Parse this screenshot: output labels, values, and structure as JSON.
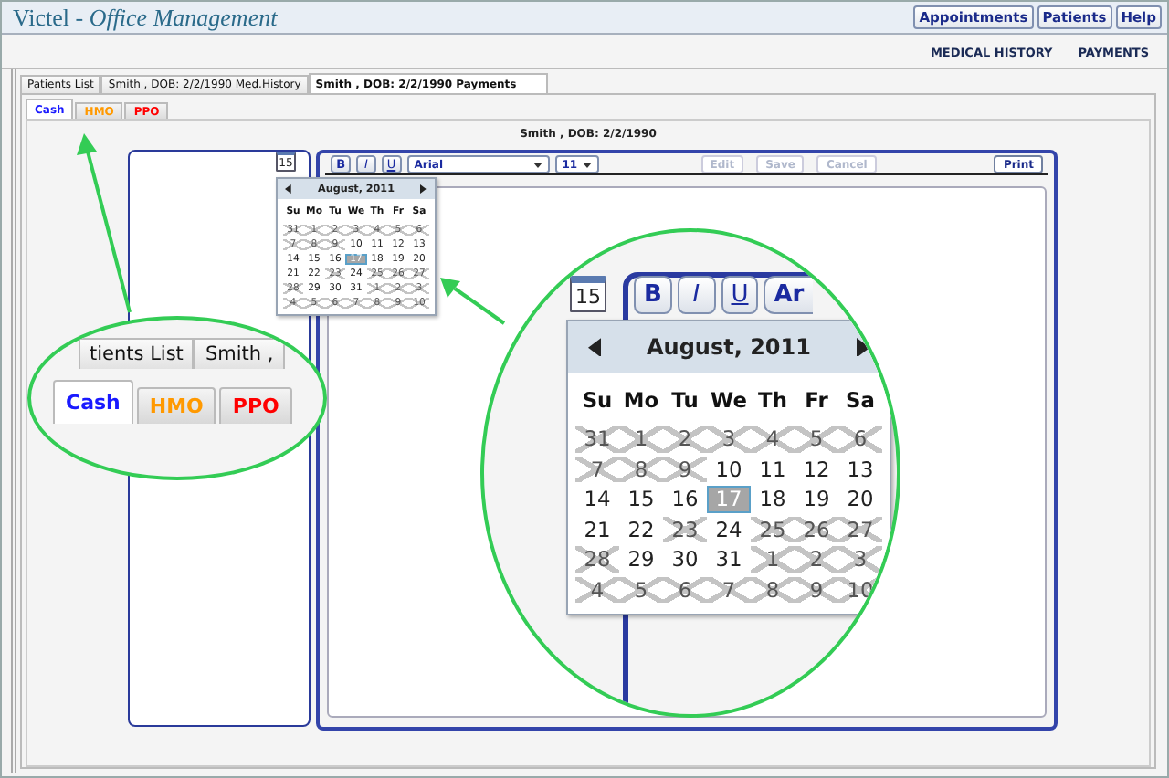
{
  "header": {
    "title": "Victel - *Office Management*",
    "buttons": [
      "Appointments",
      "Patients",
      "Help"
    ]
  },
  "nav_links": [
    "MEDICAL HISTORY",
    "PAYMENTS"
  ],
  "tabs": [
    {
      "label": "Patients List",
      "selected": false
    },
    {
      "label": "Smith , DOB: 2/2/1990 Med.History",
      "selected": false
    },
    {
      "label": "Smith , DOB: 2/2/1990 Payments",
      "selected": true
    }
  ],
  "payment_tabs": [
    {
      "label": "Cash",
      "selected": true,
      "color": "#1a1aff"
    },
    {
      "label": "HMO",
      "selected": false,
      "color": "#ff9900"
    },
    {
      "label": "PPO",
      "selected": false,
      "color": "#ff0000"
    }
  ],
  "patient_heading": "Smith , DOB: 2/2/1990",
  "calendar_icon": "15",
  "toolbar": {
    "format_buttons": [
      {
        "label": "B",
        "kind": "bold"
      },
      {
        "label": "I",
        "kind": "italic"
      },
      {
        "label": "U",
        "kind": "underline"
      }
    ],
    "font": "Arial",
    "size": "11",
    "actions": [
      {
        "label": "Edit",
        "disabled": true
      },
      {
        "label": "Save",
        "disabled": true
      },
      {
        "label": "Cancel",
        "disabled": true
      },
      {
        "label": "Print",
        "disabled": false
      }
    ]
  },
  "calendar": {
    "title": "August, 2011",
    "weekdays": [
      "Su",
      "Mo",
      "Tu",
      "We",
      "Th",
      "Fr",
      "Sa"
    ],
    "days": [
      {
        "day": "31",
        "disabled": true,
        "selected": false
      },
      {
        "day": "1",
        "disabled": true,
        "selected": false
      },
      {
        "day": "2",
        "disabled": true,
        "selected": false
      },
      {
        "day": "3",
        "disabled": true,
        "selected": false
      },
      {
        "day": "4",
        "disabled": true,
        "selected": false
      },
      {
        "day": "5",
        "disabled": true,
        "selected": false
      },
      {
        "day": "6",
        "disabled": true,
        "selected": false
      },
      {
        "day": "7",
        "disabled": true,
        "selected": false
      },
      {
        "day": "8",
        "disabled": true,
        "selected": false
      },
      {
        "day": "9",
        "disabled": true,
        "selected": false
      },
      {
        "day": "10",
        "disabled": false,
        "selected": false
      },
      {
        "day": "11",
        "disabled": false,
        "selected": false
      },
      {
        "day": "12",
        "disabled": false,
        "selected": false
      },
      {
        "day": "13",
        "disabled": false,
        "selected": false
      },
      {
        "day": "14",
        "disabled": false,
        "selected": false
      },
      {
        "day": "15",
        "disabled": false,
        "selected": false
      },
      {
        "day": "16",
        "disabled": false,
        "selected": false
      },
      {
        "day": "17",
        "disabled": false,
        "selected": true
      },
      {
        "day": "18",
        "disabled": false,
        "selected": false
      },
      {
        "day": "19",
        "disabled": false,
        "selected": false
      },
      {
        "day": "20",
        "disabled": false,
        "selected": false
      },
      {
        "day": "21",
        "disabled": false,
        "selected": false
      },
      {
        "day": "22",
        "disabled": false,
        "selected": false
      },
      {
        "day": "23",
        "disabled": true,
        "selected": false
      },
      {
        "day": "24",
        "disabled": false,
        "selected": false
      },
      {
        "day": "25",
        "disabled": true,
        "selected": false
      },
      {
        "day": "26",
        "disabled": true,
        "selected": false
      },
      {
        "day": "27",
        "disabled": true,
        "selected": false
      },
      {
        "day": "28",
        "disabled": true,
        "selected": false
      },
      {
        "day": "29",
        "disabled": false,
        "selected": false
      },
      {
        "day": "30",
        "disabled": false,
        "selected": false
      },
      {
        "day": "31",
        "disabled": false,
        "selected": false
      },
      {
        "day": "1",
        "disabled": true,
        "selected": false
      },
      {
        "day": "2",
        "disabled": true,
        "selected": false
      },
      {
        "day": "3",
        "disabled": true,
        "selected": false
      },
      {
        "day": "4",
        "disabled": true,
        "selected": false
      },
      {
        "day": "5",
        "disabled": true,
        "selected": false
      },
      {
        "day": "6",
        "disabled": true,
        "selected": false
      },
      {
        "day": "7",
        "disabled": true,
        "selected": false
      },
      {
        "day": "8",
        "disabled": true,
        "selected": false
      },
      {
        "day": "9",
        "disabled": true,
        "selected": false
      },
      {
        "day": "10",
        "disabled": true,
        "selected": false
      }
    ]
  },
  "zoom_left": {
    "tabs": [
      {
        "label": "tients List",
        "selected": false
      },
      {
        "label": "Smith ,",
        "selected": false
      }
    ],
    "payment_tabs": [
      {
        "label": "Cash",
        "selected": true,
        "color": "#1a1aff"
      },
      {
        "label": "HMO",
        "selected": false,
        "color": "#ff9900"
      },
      {
        "label": "PPO",
        "selected": false,
        "color": "#ff0000"
      }
    ]
  },
  "zoom_right": {
    "calendar_icon": "15",
    "format_buttons": [
      {
        "label": "B",
        "kind": "bold"
      },
      {
        "label": "I",
        "kind": "italic"
      },
      {
        "label": "U",
        "kind": "underline"
      }
    ],
    "font": "Ar",
    "calendar": {
      "title": "August, 2011",
      "weekdays": [
        "Su",
        "Mo",
        "Tu",
        "We",
        "Th",
        "Fr",
        "Sa"
      ],
      "days": [
        {
          "day": "31",
          "disabled": true,
          "selected": false
        },
        {
          "day": "1",
          "disabled": true,
          "selected": false
        },
        {
          "day": "2",
          "disabled": true,
          "selected": false
        },
        {
          "day": "3",
          "disabled": true,
          "selected": false
        },
        {
          "day": "4",
          "disabled": true,
          "selected": false
        },
        {
          "day": "5",
          "disabled": true,
          "selected": false
        },
        {
          "day": "6",
          "disabled": true,
          "selected": false
        },
        {
          "day": "7",
          "disabled": true,
          "selected": false
        },
        {
          "day": "8",
          "disabled": true,
          "selected": false
        },
        {
          "day": "9",
          "disabled": true,
          "selected": false
        },
        {
          "day": "10",
          "disabled": false,
          "selected": false
        },
        {
          "day": "11",
          "disabled": false,
          "selected": false
        },
        {
          "day": "12",
          "disabled": false,
          "selected": false
        },
        {
          "day": "13",
          "disabled": false,
          "selected": false
        },
        {
          "day": "14",
          "disabled": false,
          "selected": false
        },
        {
          "day": "15",
          "disabled": false,
          "selected": false
        },
        {
          "day": "16",
          "disabled": false,
          "selected": false
        },
        {
          "day": "17",
          "disabled": false,
          "selected": true
        },
        {
          "day": "18",
          "disabled": false,
          "selected": false
        },
        {
          "day": "19",
          "disabled": false,
          "selected": false
        },
        {
          "day": "20",
          "disabled": false,
          "selected": false
        },
        {
          "day": "21",
          "disabled": false,
          "selected": false
        },
        {
          "day": "22",
          "disabled": false,
          "selected": false
        },
        {
          "day": "23",
          "disabled": true,
          "selected": false
        },
        {
          "day": "24",
          "disabled": false,
          "selected": false
        },
        {
          "day": "25",
          "disabled": true,
          "selected": false
        },
        {
          "day": "26",
          "disabled": true,
          "selected": false
        },
        {
          "day": "27",
          "disabled": true,
          "selected": false
        },
        {
          "day": "28",
          "disabled": true,
          "selected": false
        },
        {
          "day": "29",
          "disabled": false,
          "selected": false
        },
        {
          "day": "30",
          "disabled": false,
          "selected": false
        },
        {
          "day": "31",
          "disabled": false,
          "selected": false
        },
        {
          "day": "1",
          "disabled": true,
          "selected": false
        },
        {
          "day": "2",
          "disabled": true,
          "selected": false
        },
        {
          "day": "3",
          "disabled": true,
          "selected": false
        },
        {
          "day": "4",
          "disabled": true,
          "selected": false
        },
        {
          "day": "5",
          "disabled": true,
          "selected": false
        },
        {
          "day": "6",
          "disabled": true,
          "selected": false
        },
        {
          "day": "7",
          "disabled": true,
          "selected": false
        },
        {
          "day": "8",
          "disabled": true,
          "selected": false
        },
        {
          "day": "9",
          "disabled": true,
          "selected": false
        },
        {
          "day": "10",
          "disabled": true,
          "selected": false
        }
      ]
    }
  }
}
